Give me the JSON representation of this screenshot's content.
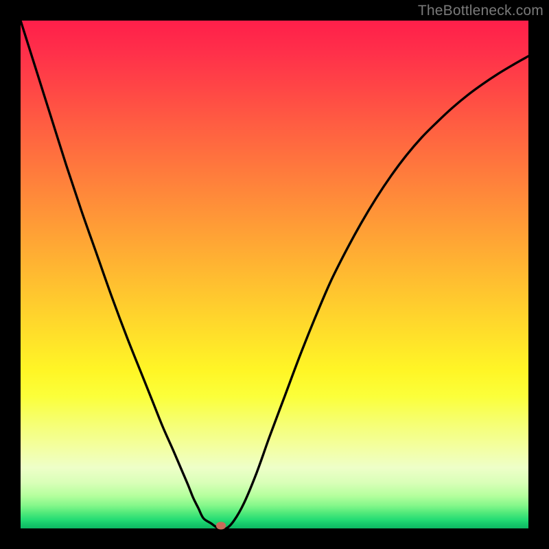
{
  "watermark": "TheBottleneck.com",
  "colors": {
    "background": "#000000",
    "curve_stroke": "#000000",
    "marker_fill": "#c86b5a"
  },
  "chart_data": {
    "type": "line",
    "title": "",
    "xlabel": "",
    "ylabel": "",
    "xlim": [
      0,
      100
    ],
    "ylim": [
      0,
      100
    ],
    "grid": false,
    "legend": false,
    "series": [
      {
        "name": "curve",
        "x": [
          0,
          3,
          6,
          9,
          12,
          15,
          18,
          21,
          24,
          26,
          28,
          30,
          31.5,
          33,
          34,
          35,
          36,
          37.5,
          39,
          40.5,
          42,
          44,
          46.5,
          49,
          52,
          55,
          58,
          61,
          64,
          67,
          70,
          73,
          76,
          79,
          82,
          85,
          88,
          91,
          94,
          97,
          100
        ],
        "y": [
          100,
          90.5,
          81,
          71.5,
          62.5,
          54,
          45.5,
          37.5,
          30,
          25,
          20,
          15.5,
          12,
          8.5,
          6,
          4,
          2,
          1,
          0,
          0,
          1.5,
          5,
          11,
          18,
          26,
          34,
          41.5,
          48.5,
          54.5,
          60,
          65,
          69.5,
          73.5,
          77,
          80,
          82.8,
          85.3,
          87.5,
          89.5,
          91.3,
          93
        ]
      }
    ],
    "marker": {
      "x": 39.5,
      "y": 0.5
    },
    "gradient_stops": [
      {
        "pos": 0,
        "color": "#ff1f4a"
      },
      {
        "pos": 0.48,
        "color": "#ffb432"
      },
      {
        "pos": 0.74,
        "color": "#fbff3a"
      },
      {
        "pos": 0.95,
        "color": "#4fe97a"
      },
      {
        "pos": 1.0,
        "color": "#0fb863"
      }
    ]
  }
}
